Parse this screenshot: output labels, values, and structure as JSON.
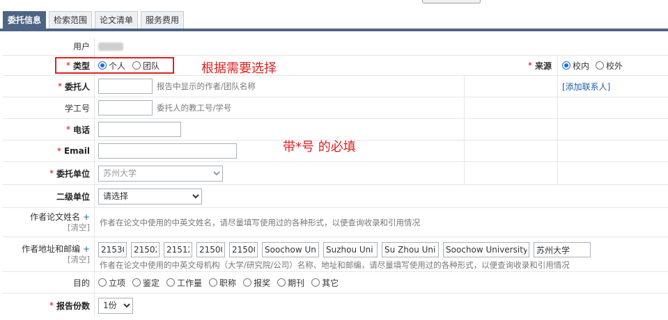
{
  "tabs": [
    {
      "label": "委托信息",
      "active": true
    },
    {
      "label": "检索范围",
      "active": false
    },
    {
      "label": "论文清单",
      "active": false
    },
    {
      "label": "服务费用",
      "active": false
    }
  ],
  "user": {
    "label": "用户"
  },
  "type_row": {
    "label": "类型",
    "options": [
      "个人",
      "团队"
    ],
    "selected": "个人"
  },
  "source_row": {
    "label": "来源",
    "options": [
      "校内",
      "校外"
    ],
    "selected": "校内"
  },
  "client_row": {
    "label": "委托人",
    "hint": "报告中显示的作者/团队名称",
    "add_contact": "[添加联系人]"
  },
  "staff_id_row": {
    "label": "学工号",
    "hint": "委托人的教工号/学号"
  },
  "phone_row": {
    "label": "电话"
  },
  "email_row": {
    "label": "Email"
  },
  "unit_row": {
    "label": "委托单位",
    "value": "苏州大学"
  },
  "subunit_row": {
    "label": "二级单位",
    "value": "请选择"
  },
  "author_name_row": {
    "label": "作者论文姓名",
    "plus": "+",
    "reset": "[清空]",
    "hint": "作者在论文中使用的中英文姓名，请尽量填写使用过的各种形式，以便查询收录和引用情况"
  },
  "author_addr_row": {
    "label": "作者地址和邮编",
    "plus": "+",
    "reset": "[清空]",
    "values": [
      "21530",
      "21502",
      "21512",
      "21500",
      "21500",
      "Soochow Un",
      "Suzhou Uni",
      "Su Zhou Uni",
      "Soochow University",
      "苏州大学"
    ],
    "hint": "作者在论文中使用的中英文母机构（大学/研究院/公司）名称、地址和邮编，请尽量填写使用过的各种形式，以便查询收录和引用情况"
  },
  "purpose_row": {
    "label": "目的",
    "options": [
      "立项",
      "鉴定",
      "工作量",
      "职称",
      "报奖",
      "期刊",
      "其它"
    ]
  },
  "copies_row": {
    "label": "报告份数",
    "value": "1份"
  },
  "annotations": {
    "choose_note": "根据需要选择",
    "required_note": "带*号 的必填"
  },
  "colors": {
    "tab_active": "#4d6485",
    "required_star": "#dd0000",
    "annotation": "#e02020",
    "link": "#1d5fa8"
  }
}
